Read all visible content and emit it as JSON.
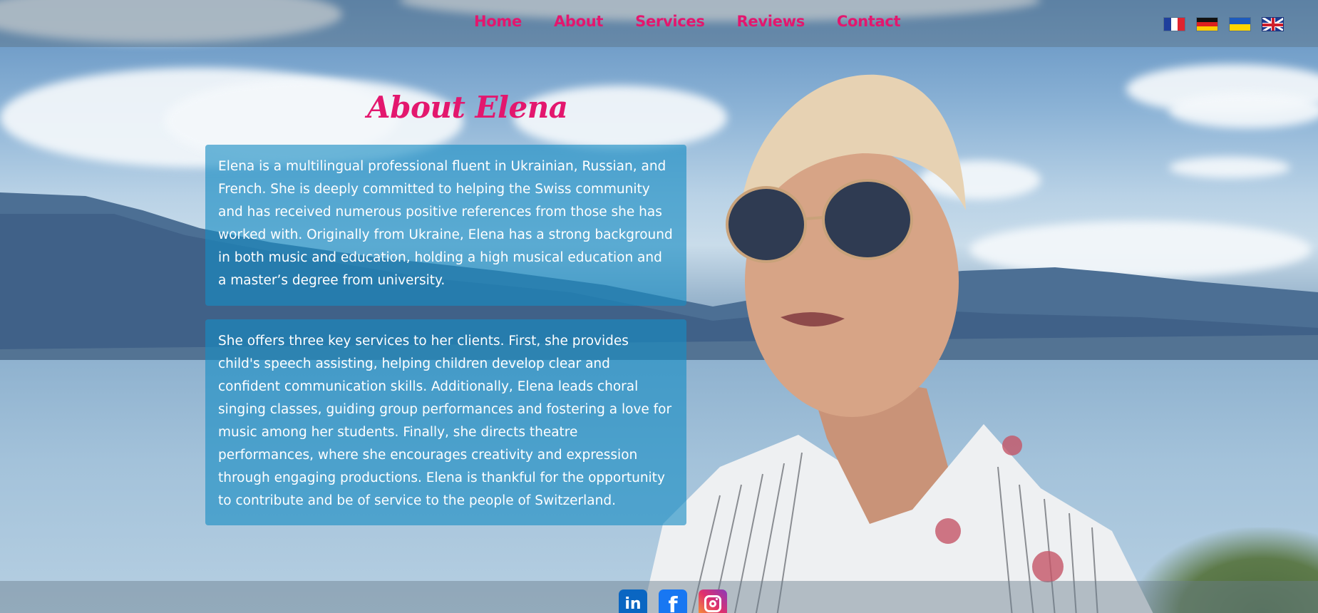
{
  "nav": {
    "items": [
      {
        "label": "Home"
      },
      {
        "label": "About"
      },
      {
        "label": "Services"
      },
      {
        "label": "Reviews"
      },
      {
        "label": "Contact"
      }
    ],
    "color": "#e3176e"
  },
  "languages": [
    {
      "code": "fr",
      "icon": "france-flag-icon"
    },
    {
      "code": "de",
      "icon": "germany-flag-icon"
    },
    {
      "code": "uk",
      "icon": "ukraine-flag-icon"
    },
    {
      "code": "en",
      "icon": "uk-flag-icon"
    }
  ],
  "about": {
    "heading": "About Elena",
    "paragraph_1": "Elena is a multilingual professional fluent in Ukrainian, Russian, and French. She is deeply committed to helping the Swiss community and has received numerous positive references from those she has worked with. Originally from Ukraine, Elena has a strong background in both music and education, holding a high musical education and a master’s degree from university.",
    "paragraph_2": "She offers three key services to her clients. First, she provides child's speech assisting, helping children develop clear and confident communication skills. Additionally, Elena leads choral singing classes, guiding group performances and fostering a love for music among her students. Finally, she directs theatre performances, where she encourages creativity and expression through engaging productions. Elena is thankful for the opportunity to contribute and be of service to the people of Switzerland."
  },
  "social": [
    {
      "icon": "linkedin-icon",
      "glyph": "in"
    },
    {
      "icon": "facebook-icon",
      "glyph": "f"
    },
    {
      "icon": "instagram-icon",
      "glyph": ""
    }
  ],
  "colors": {
    "accent": "#e3176e",
    "card_bg": "rgba(22,140,196,0.62)"
  }
}
